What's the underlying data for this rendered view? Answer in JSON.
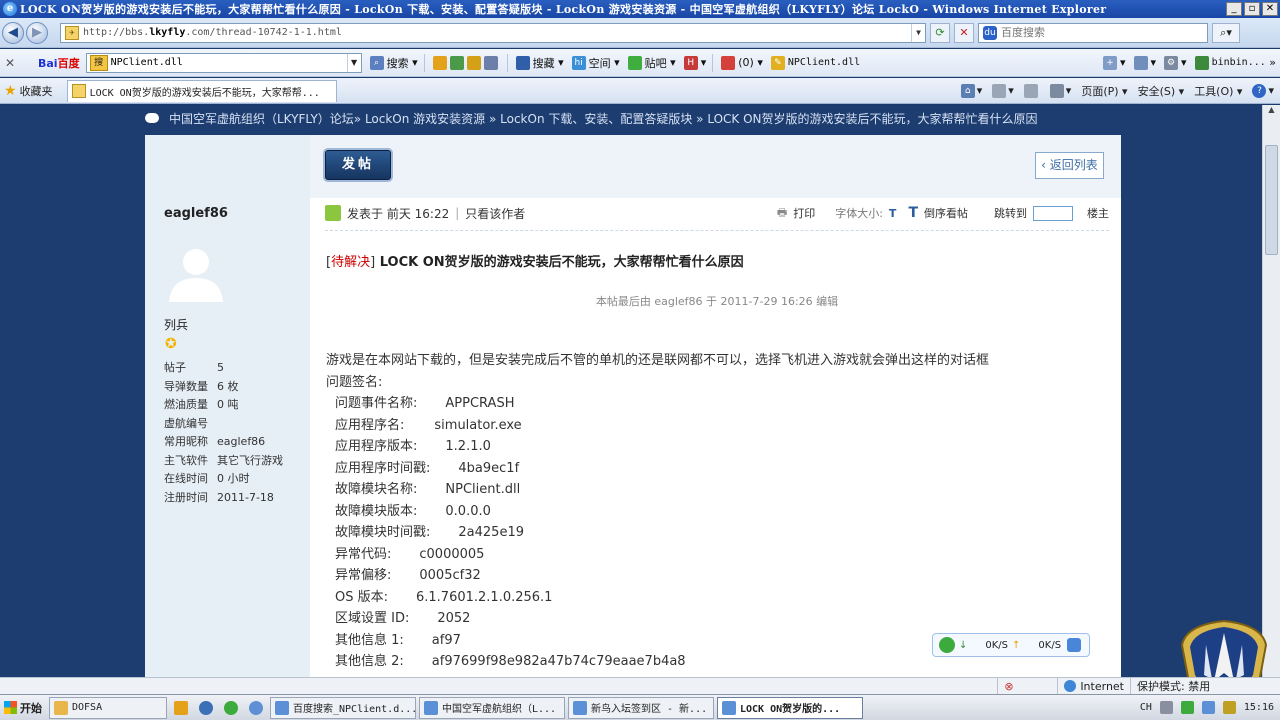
{
  "window": {
    "title": "LOCK ON贺岁版的游戏安装后不能玩，大家帮帮忙看什么原因 - LockOn 下载、安装、配置答疑版块 - LockOn 游戏安装资源 - 中国空军虚航组织（LKYFLY）论坛 LockO - Windows Internet Explorer",
    "min": "_",
    "max": "▫",
    "close": "✕"
  },
  "address": {
    "url_prefix": "http://bbs.",
    "url_host": "lkyfly",
    "url_rest": ".com/thread-10742-1-1.html",
    "search_placeholder": "百度搜索"
  },
  "toolbar": {
    "logo_bai": "Bai",
    "logo_du": "百度",
    "query": "NPClient.dll",
    "items": [
      "搜索",
      "搜藏",
      "空间",
      "贴吧",
      "(0)",
      "NPClient.dll",
      "binbin..."
    ]
  },
  "favorites": {
    "label": "收藏夹",
    "tab_title": "LOCK ON贺岁版的游戏安装后不能玩，大家帮帮...",
    "commands": [
      "页面(P)",
      "安全(S)",
      "工具(O)"
    ]
  },
  "breadcrumb": {
    "text": "中国空军虚航组织（LKYFLY）论坛» LockOn 游戏安装资源 » LockOn 下载、安装、配置答疑版块 » LOCK ON贺岁版的游戏安装后不能玩，大家帮帮忙看什么原因"
  },
  "actions": {
    "post": "发帖",
    "back": "返回列表"
  },
  "author": {
    "name": "eaglef86",
    "rank": "列兵",
    "stats": [
      {
        "k": "帖子",
        "v": "5"
      },
      {
        "k": "导弹数量",
        "v": "6 枚"
      },
      {
        "k": "燃油质量",
        "v": "0 吨"
      },
      {
        "k": "虚航编号",
        "v": ""
      },
      {
        "k": "常用昵称",
        "v": "eaglef86"
      },
      {
        "k": "主飞软件",
        "v": "其它飞行游戏"
      },
      {
        "k": "在线时间",
        "v": "0 小时"
      },
      {
        "k": "注册时间",
        "v": "2011-7-18"
      }
    ]
  },
  "post": {
    "posted": "发表于 前天 16:22",
    "only_author": "只看该作者",
    "print": "打印",
    "font_size": "字体大小:",
    "font_t1": "T",
    "font_t2": "T",
    "reverse": "倒序看帖",
    "jump": "跳转到",
    "floor": "楼主",
    "tag_open": "[",
    "tag": "待解决",
    "tag_close": "]",
    "title": "LOCK ON贺岁版的游戏安装后不能玩，大家帮帮忙看什么原因",
    "edit_note": "本帖最后由 eaglef86 于 2011-7-29 16:26 编辑",
    "intro": "游戏是在本网站下载的，但是安装完成后不管的单机的还是联网都不可以，选择飞机进入游戏就会弹出这样的对话框",
    "sig_label": "问题签名:",
    "details": [
      {
        "k": "问题事件名称:",
        "v": "APPCRASH",
        "pad": 28
      },
      {
        "k": "应用程序名:",
        "v": "simulator.exe",
        "pad": 30
      },
      {
        "k": "应用程序版本:",
        "v": "1.2.1.0",
        "pad": 28
      },
      {
        "k": "应用程序时间戳:",
        "v": "4ba9ec1f",
        "pad": 28
      },
      {
        "k": "故障模块名称:",
        "v": "NPClient.dll",
        "pad": 28
      },
      {
        "k": "故障模块版本:",
        "v": "0.0.0.0",
        "pad": 28
      },
      {
        "k": "故障模块时间戳:",
        "v": "2a425e19",
        "pad": 28
      },
      {
        "k": "异常代码:",
        "v": "c0000005",
        "pad": 28
      },
      {
        "k": "异常偏移:",
        "v": "0005cf32",
        "pad": 28
      },
      {
        "k": "OS 版本:",
        "v": "6.1.7601.2.1.0.256.1",
        "pad": 28
      },
      {
        "k": "区域设置 ID:",
        "v": "2052",
        "pad": 28
      },
      {
        "k": "其他信息 1:",
        "v": "af97",
        "pad": 28
      },
      {
        "k": "其他信息 2:",
        "v": "af97699f98e982a47b74c79eaae7b4a8",
        "pad": 28
      }
    ]
  },
  "speed": {
    "down": "0K/S",
    "up": "0K/S"
  },
  "status": {
    "zone": "Internet",
    "mode": "保护模式: 禁用"
  },
  "taskbar": {
    "start": "开始",
    "tasks": [
      "DOFSA",
      "百度搜索_NPClient.d...",
      "中国空军虚航组织（L...",
      "新鸟入坛签到区 - 新...",
      "LOCK ON贺岁版的..."
    ],
    "lang": "CH",
    "clock": "15:16"
  }
}
